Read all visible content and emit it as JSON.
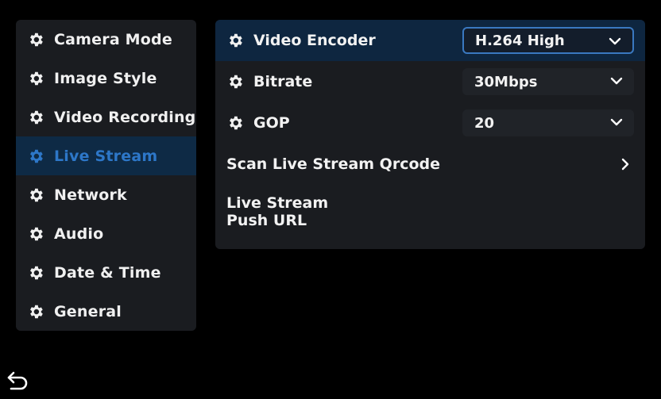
{
  "sidebar": {
    "items": [
      {
        "label": "Camera Mode",
        "icon": "gear-icon",
        "active": false
      },
      {
        "label": "Image Style",
        "icon": "gear-icon",
        "active": false
      },
      {
        "label": "Video Recording",
        "icon": "gear-icon",
        "active": false
      },
      {
        "label": "Live Stream",
        "icon": "gear-icon",
        "active": true
      },
      {
        "label": "Network",
        "icon": "gear-icon",
        "active": false
      },
      {
        "label": "Audio",
        "icon": "gear-icon",
        "active": false
      },
      {
        "label": "Date & Time",
        "icon": "gear-icon",
        "active": false
      },
      {
        "label": "General",
        "icon": "gear-icon",
        "active": false
      }
    ]
  },
  "settings": {
    "video_encoder": {
      "label": "Video Encoder",
      "value": "H.264 High",
      "icon": "gear-icon"
    },
    "bitrate": {
      "label": "Bitrate",
      "value": "30Mbps",
      "icon": "gear-icon"
    },
    "gop": {
      "label": "GOP",
      "value": "20",
      "icon": "gear-icon"
    },
    "scan_qrcode": {
      "label": "Scan Live Stream Qrcode",
      "icon": "chevron-right-icon"
    },
    "push_url": {
      "label_line1": "Live Stream",
      "label_line2": "Push URL"
    }
  },
  "nav": {
    "back_icon": "back-arrow-icon"
  },
  "colors": {
    "background": "#000000",
    "panel": "#1a1c20",
    "accent": "#2d77c8",
    "selected_row": "#0e2640",
    "text": "#f2f2f2"
  }
}
